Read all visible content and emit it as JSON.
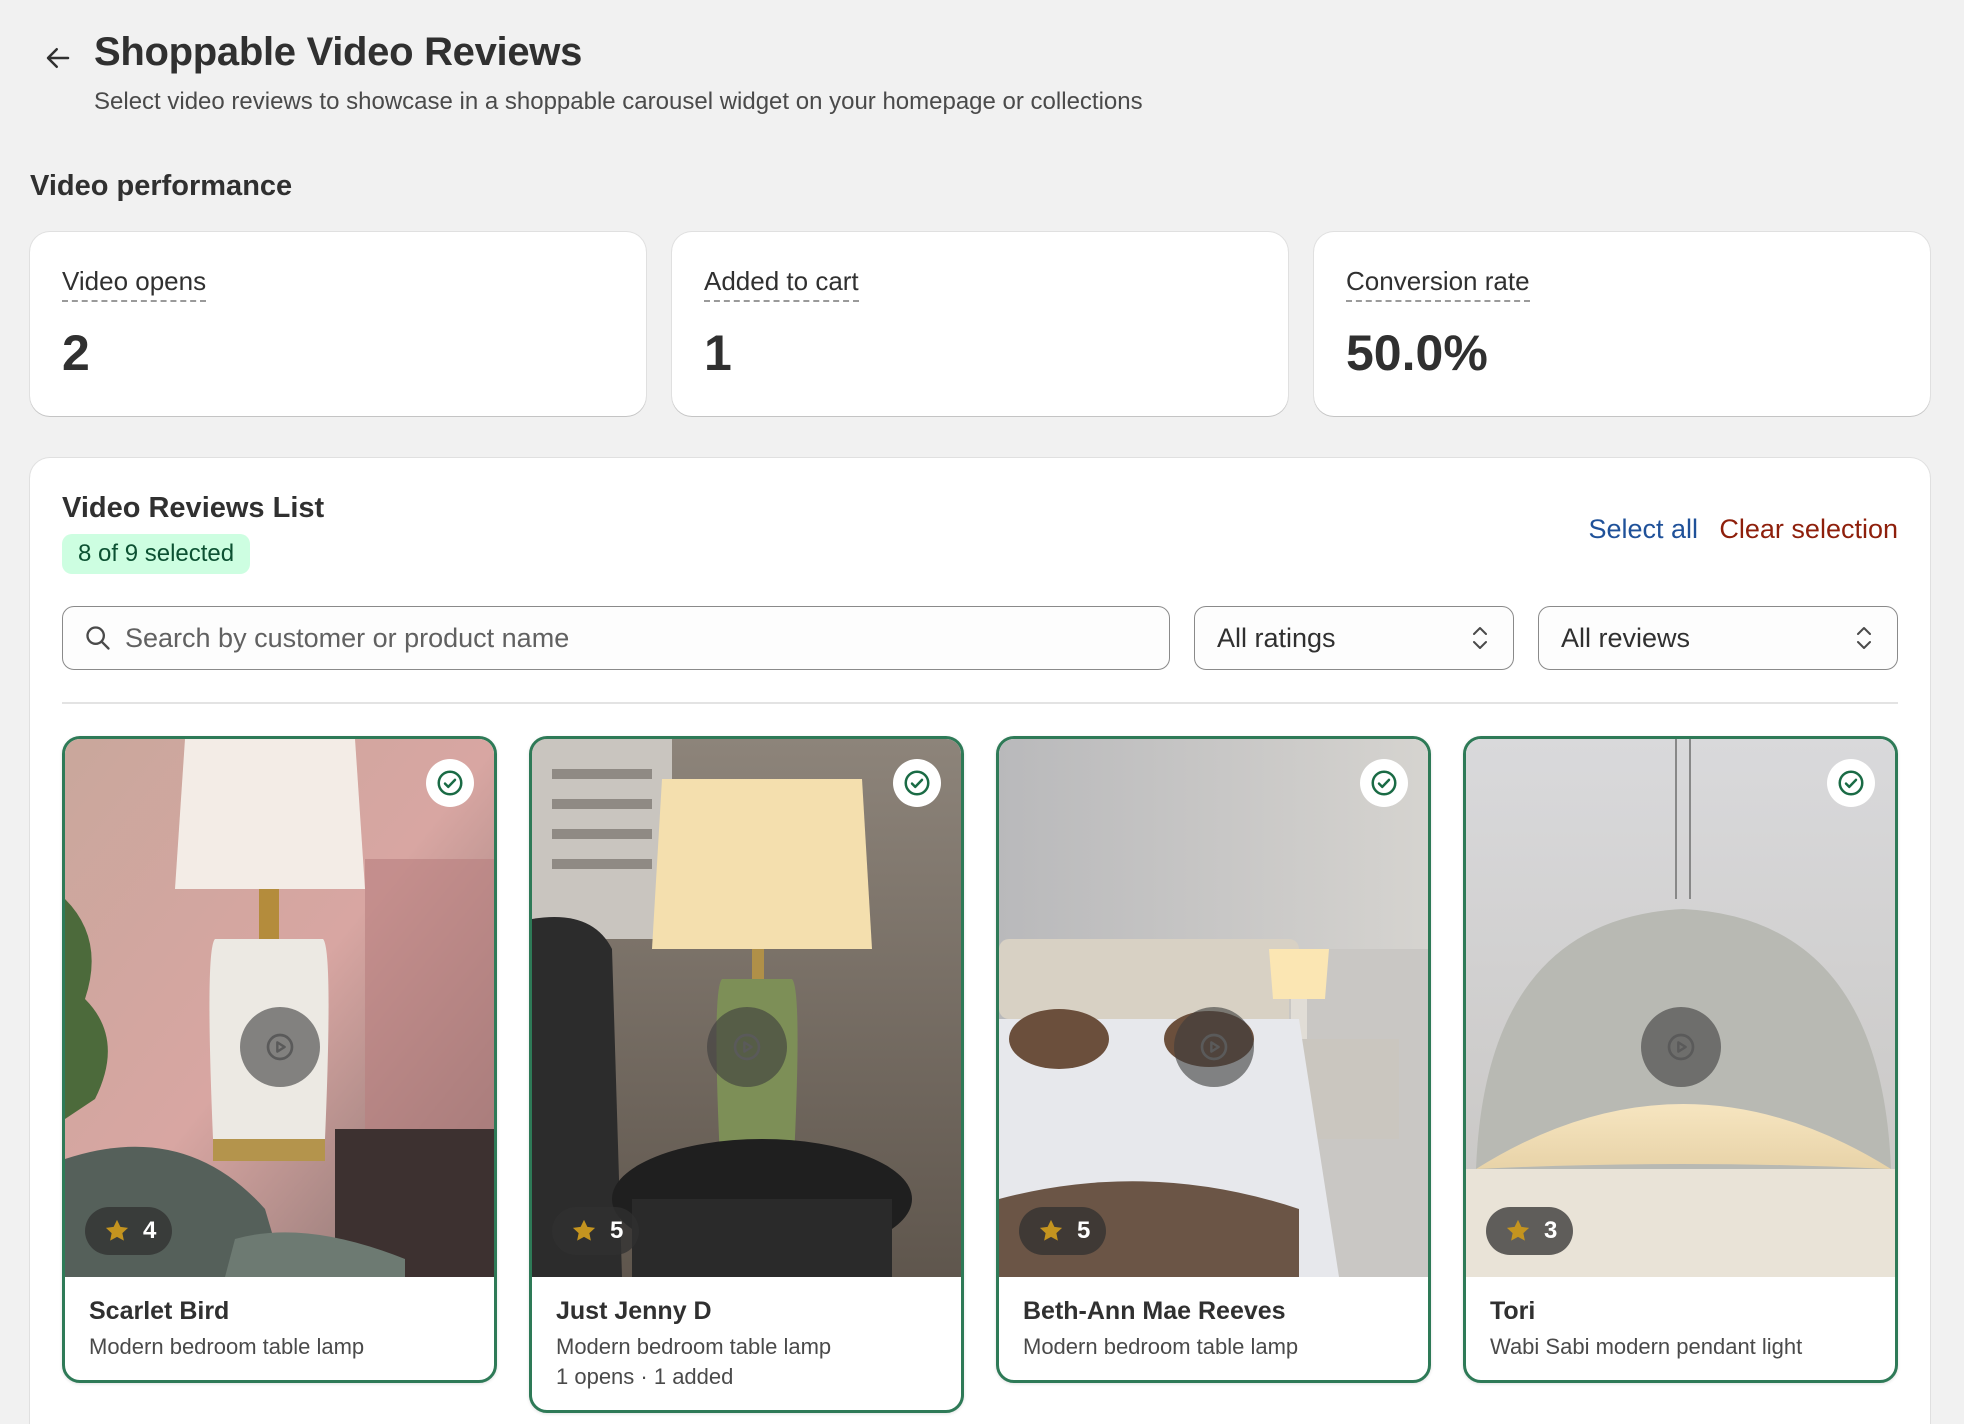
{
  "header": {
    "title": "Shoppable Video Reviews",
    "subtitle": "Select video reviews to showcase in a shoppable carousel widget on your homepage or collections"
  },
  "performance": {
    "section_title": "Video performance",
    "metrics": [
      {
        "label": "Video opens",
        "value": "2"
      },
      {
        "label": "Added to cart",
        "value": "1"
      },
      {
        "label": "Conversion rate",
        "value": "50.0%"
      }
    ]
  },
  "reviews_list": {
    "title": "Video Reviews List",
    "selected_badge": "8 of 9 selected",
    "select_all": "Select all",
    "clear_selection": "Clear selection",
    "search": {
      "placeholder": "Search by customer or product name",
      "value": ""
    },
    "ratings_filter": "All ratings",
    "reviews_filter": "All reviews",
    "items": [
      {
        "customer": "Scarlet Bird",
        "product": "Modern bedroom table lamp",
        "rating": "4",
        "stats": "",
        "selected": true
      },
      {
        "customer": "Just Jenny D",
        "product": "Modern bedroom table lamp",
        "rating": "5",
        "stats": "1 opens · 1 added",
        "selected": true
      },
      {
        "customer": "Beth-Ann Mae Reeves",
        "product": "Modern bedroom table lamp",
        "rating": "5",
        "stats": "",
        "selected": true
      },
      {
        "customer": "Tori",
        "product": "Wabi Sabi modern pendant light",
        "rating": "3",
        "stats": "",
        "selected": true
      }
    ]
  },
  "colors": {
    "accent_green": "#2e7a57",
    "badge_bg": "#cdfee1",
    "link_blue": "#1f5199",
    "link_red": "#8e1f0b",
    "star": "#c4941f"
  }
}
